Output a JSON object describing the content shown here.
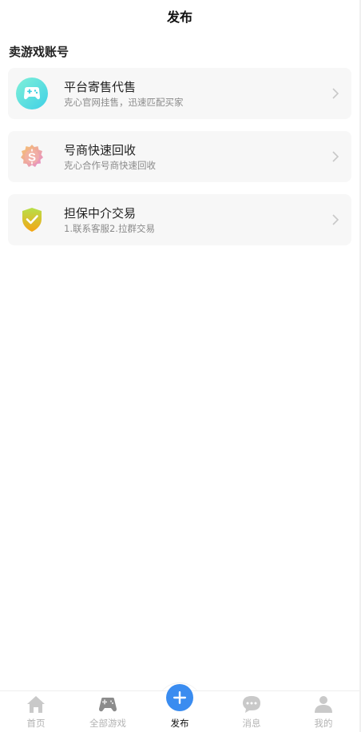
{
  "header": {
    "title": "发布"
  },
  "section": {
    "title": "卖游戏账号"
  },
  "cards": [
    {
      "title": "平台寄售代售",
      "subtitle": "克心官网挂售，迅速匹配买家",
      "icon": "gamepad-icon"
    },
    {
      "title": "号商快速回收",
      "subtitle": "克心合作号商快速回收",
      "icon": "dollar-badge-icon"
    },
    {
      "title": "担保中介交易",
      "subtitle": "1.联系客服2.拉群交易",
      "icon": "shield-check-icon"
    }
  ],
  "tabbar": {
    "items": [
      {
        "label": "首页",
        "icon": "home-icon"
      },
      {
        "label": "全部游戏",
        "icon": "gamepad-icon"
      },
      {
        "label": "发布",
        "icon": "plus-icon",
        "active": true
      },
      {
        "label": "消息",
        "icon": "chat-icon"
      },
      {
        "label": "我的",
        "icon": "user-icon"
      }
    ]
  },
  "colors": {
    "accent": "#3a8cf0",
    "inactive": "#b3b3b3",
    "card_bg": "#f7f7f7"
  }
}
